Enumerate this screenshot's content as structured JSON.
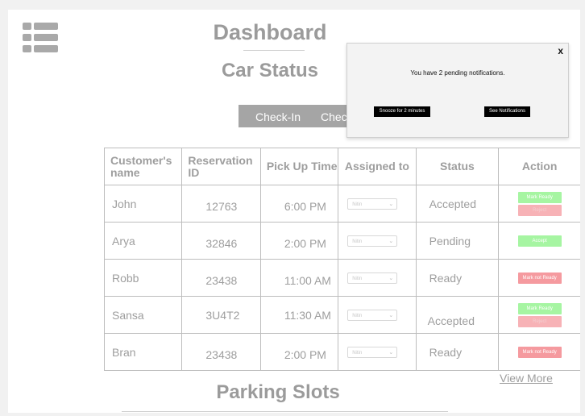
{
  "header": {
    "title": "Dashboard",
    "section_title": "Car Status"
  },
  "tabs": [
    {
      "label": "Check-In"
    },
    {
      "label": "Check-Out"
    }
  ],
  "table": {
    "columns": [
      "Customer's name",
      "Reservation ID",
      "Pick Up Time",
      "Assigned to",
      "Status",
      "Action"
    ],
    "rows": [
      {
        "name": "John",
        "reservation_id": "12763",
        "pickup": "6:00 PM",
        "assigned": "Nitin",
        "status": "Accepted",
        "actions": [
          "Mark Ready",
          "Reject"
        ]
      },
      {
        "name": "Arya",
        "reservation_id": "32846",
        "pickup": "2:00 PM",
        "assigned": "Nitin",
        "status": "Pending",
        "actions": [
          "Accept"
        ]
      },
      {
        "name": "Robb",
        "reservation_id": "23438",
        "pickup": "11:00 AM",
        "assigned": "Nitin",
        "status": "Ready",
        "actions": [
          "Mark not Ready"
        ]
      },
      {
        "name": "Sansa",
        "reservation_id": "3U4T2",
        "pickup": "11:30 AM",
        "assigned": "Nitin",
        "status": "Accepted",
        "actions": [
          "Mark Ready",
          "Reject"
        ]
      },
      {
        "name": "Bran",
        "reservation_id": "23438",
        "pickup": "2:00 PM",
        "assigned": "Nitin",
        "status": "Ready",
        "actions": [
          "Mark not Ready"
        ]
      }
    ],
    "view_more": "View More"
  },
  "parking": {
    "title": "Parking Slots"
  },
  "notification": {
    "close_label": "x",
    "message": "You have 2 pending notifications.",
    "snooze_label": "Snooze for 2 minutes",
    "see_label": "See Notifications"
  },
  "colors": {
    "accent_green": "#a6f5a2",
    "accent_red": "#f59a9f",
    "button_gray": "#a5a5a5",
    "text_gray": "#9e9e9e"
  },
  "icons": [
    "list-menu-icon",
    "chevron-down-icon"
  ]
}
